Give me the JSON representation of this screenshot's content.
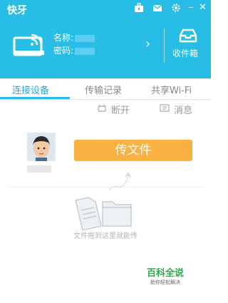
{
  "app": {
    "title": "快牙"
  },
  "header": {
    "name_label": "名称:",
    "code_label": "密码:",
    "inbox_label": "收件箱"
  },
  "tabs": [
    {
      "label": "连接设备"
    },
    {
      "label": "传输记录"
    },
    {
      "label": "共享Wi-Fi"
    }
  ],
  "actions": {
    "disconnect": "断开",
    "message": "消息"
  },
  "main": {
    "send_button": "传文件",
    "drop_hint": "文件拖到这里就能传"
  },
  "watermark": {
    "title": "百科全说",
    "subtitle": "助你轻松解决"
  },
  "colors": {
    "accent": "#27bde6",
    "button": "#fbb141"
  }
}
